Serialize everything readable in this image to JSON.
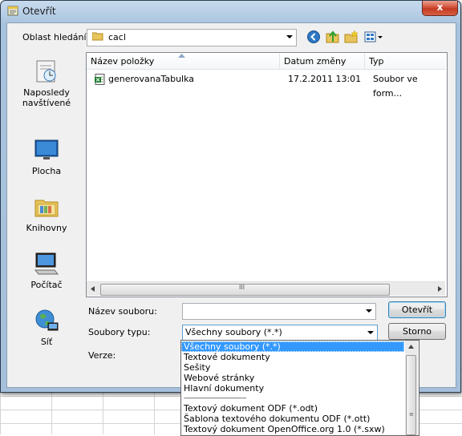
{
  "window": {
    "title": "Otevřít",
    "close_glyph": "x"
  },
  "lookin": {
    "label": "Oblast hledání:",
    "value": "cacl"
  },
  "toolbar": {
    "icons": [
      "back-icon",
      "up-folder-icon",
      "new-folder-icon",
      "view-menu-icon"
    ]
  },
  "places": [
    {
      "label": "Naposledy\nnavštívené",
      "icon": "recent-places-icon"
    },
    {
      "label": "Plocha",
      "icon": "desktop-icon"
    },
    {
      "label": "Knihovny",
      "icon": "libraries-icon"
    },
    {
      "label": "Počítač",
      "icon": "computer-icon"
    },
    {
      "label": "Síť",
      "icon": "network-icon"
    }
  ],
  "filelist": {
    "columns": [
      "Název položky",
      "Datum změny",
      "Typ"
    ],
    "rows": [
      {
        "name": "generovanaTabulka",
        "date": "17.2.2011 13:01",
        "type": "Soubor ve form..."
      }
    ],
    "hscroll_grip": "III"
  },
  "form": {
    "filename_label": "Název souboru:",
    "filename_value": "",
    "filetype_label": "Soubory typu:",
    "filetype_value": "Všechny soubory (*.*)",
    "version_label": "Verze:",
    "open_button": "Otevřít",
    "cancel_button": "Storno"
  },
  "dropdown_options": [
    "Všechny soubory (*.*)",
    "Textové dokumenty",
    "Sešity",
    "Webové stránky",
    "Hlavní dokumenty",
    "-----------------------------------------",
    "Textový dokument ODF (*.odt)",
    "Šablona textového dokumentu ODF (*.ott)",
    "Textový dokument OpenOffice.org 1.0 (*.sxw)"
  ],
  "colors": {
    "selection": "#3399ff",
    "titlebar": "#a9c3dd",
    "close": "#c23b22"
  }
}
